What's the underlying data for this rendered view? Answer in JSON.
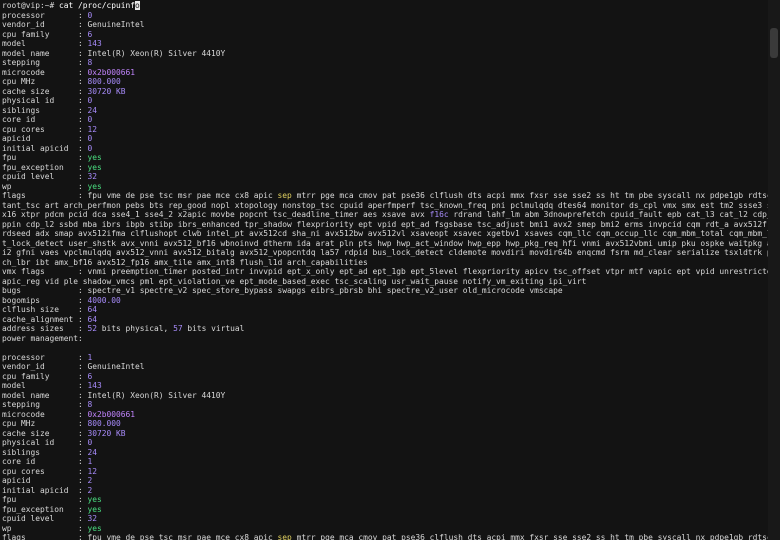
{
  "terminal": {
    "prompt": "root@vip:~#",
    "command_pre": "cat /proc/cpuinf",
    "command_hl": "o",
    "blocks": [
      {
        "lines": [
          {
            "k": "processor       ",
            "v": "0",
            "c": "num"
          },
          {
            "k": "vendor_id       ",
            "v": "GenuineIntel",
            "c": "k"
          },
          {
            "k": "cpu family      ",
            "v": "6",
            "c": "num"
          },
          {
            "k": "model           ",
            "v": "143",
            "c": "num"
          },
          {
            "k": "model name      ",
            "v": "Intel(R) Xeon(R) Silver 4410Y",
            "c": "k"
          },
          {
            "k": "stepping        ",
            "v": "8",
            "c": "num"
          },
          {
            "k": "microcode       ",
            "v": "0x2b000661",
            "c": "hex"
          },
          {
            "k": "cpu MHz         ",
            "v": "800.000",
            "c": "num"
          },
          {
            "k": "cache size      ",
            "v": "30720 KB",
            "c": "num"
          },
          {
            "k": "physical id     ",
            "v": "0",
            "c": "num"
          },
          {
            "k": "siblings        ",
            "v": "24",
            "c": "num"
          },
          {
            "k": "core id         ",
            "v": "0",
            "c": "num"
          },
          {
            "k": "cpu cores       ",
            "v": "12",
            "c": "num"
          },
          {
            "k": "apicid          ",
            "v": "0",
            "c": "num"
          },
          {
            "k": "initial apicid  ",
            "v": "0",
            "c": "num"
          },
          {
            "k": "fpu             ",
            "v": "yes",
            "c": "yes"
          },
          {
            "k": "fpu_exception   ",
            "v": "yes",
            "c": "yes"
          },
          {
            "k": "cpuid level     ",
            "v": "32",
            "c": "num"
          },
          {
            "k": "wp              ",
            "v": "yes",
            "c": "yes"
          }
        ],
        "flags_label": "flags           ",
        "flags_lines": [
          ": fpu vme de pse tsc msr pae mce cx8 apic ",
          "sep",
          " mtrr pge mca cmov pat pse36 clflush dts acpi mmx fxsr sse sse2 ss ht tm pbe syscall nx pdpe1gb rdtscp lm cons"
        ],
        "flags_rest": [
          "tant_tsc art arch_perfmon pebs bts rep_good nopl xtopology nonstop_tsc cpuid aperfmperf tsc_known_freq pni pclmulqdq dtes64 monitor ds_cpl vmx smx est tm2 ssse3 sdbg fma c",
          "x16 xtpr pdcm pcid dca sse4_1 sse4_2 x2apic movbe popcnt tsc_deadline_timer aes xsave avx ",
          "f16c",
          " rdrand lahf_lm abm 3dnowprefetch cpuid_fault epb cat_l3 cat_l2 cdp_l3 intel_",
          "ppin cdp_l2 ssbd mba ibrs ibpb stibp ibrs_enhanced tpr_shadow flexpriority ept vpid ept_ad fsgsbase tsc_adjust bmi1 avx2 smep bmi2 erms invpcid cqm rdt_a avx512f avx512dq ",
          "rdseed adx smap avx512ifma clflushopt clwb intel_pt avx512cd sha_ni avx512bw avx512vl xsaveopt xsavec xgetbv1 xsaves cqm_llc cqm_occup_llc cqm_mbm_total cqm_mbm_local spli",
          "t_lock_detect user_shstk avx_vnni avx512_bf16 wbnoinvd dtherm ida arat pln pts hwp hwp_act_window hwp_epp hwp_pkg_req hfi vnmi avx512vbmi umip pku ospke waitpkg avx512_vbm",
          "i2 gfni vaes vpclmulqdq avx512_vnni avx512_bitalg avx512_vpopcntdq la57 rdpid bus_lock_detect cldemote movdiri movdir64b enqcmd fsrm md_clear serialize tsxldtrk pconfig ar",
          "ch_lbr ibt amx_bf16 avx512_fp16 amx_tile amx_int8 flush_l1d arch_capabilities"
        ],
        "vmx_label": "vmx flags       ",
        "vmx_lines": [
          ": vnmi preemption_timer posted_intr invvpid ept_x_only ept_ad ept_1gb ept_5level flexpriority apicv tsc_offset vtpr mtf vapic ept vpid unrestricted_guest v",
          "apic_reg vid ple shadow_vmcs pml ept_violation_ve ept_mode_based_exec tsc_scaling usr_wait_pause notify_vm_exiting ipi_virt"
        ],
        "bugs_label": "bugs            ",
        "bugs_value": ": spectre_v1 spectre_v2 spec_store_bypass swapgs eibrs_pbrsb bhi spectre_v2_user old_microcode vmscape",
        "bogomips_label": "bogomips        ",
        "bogomips_value": "4000.00",
        "clflush_label": "clflush size    ",
        "clflush_value": "64",
        "cache_align_label": "cache_alignment ",
        "cache_align_value": "64",
        "addr_label": "address sizes   ",
        "addr_phys": "52",
        "addr_mid": " bits physical, ",
        "addr_virt": "57",
        "addr_end": " bits virtual",
        "power_label": "power management:"
      },
      {
        "lines": [
          {
            "k": "processor       ",
            "v": "1",
            "c": "num"
          },
          {
            "k": "vendor_id       ",
            "v": "GenuineIntel",
            "c": "k"
          },
          {
            "k": "cpu family      ",
            "v": "6",
            "c": "num"
          },
          {
            "k": "model           ",
            "v": "143",
            "c": "num"
          },
          {
            "k": "model name      ",
            "v": "Intel(R) Xeon(R) Silver 4410Y",
            "c": "k"
          },
          {
            "k": "stepping        ",
            "v": "8",
            "c": "num"
          },
          {
            "k": "microcode       ",
            "v": "0x2b000661",
            "c": "hex"
          },
          {
            "k": "cpu MHz         ",
            "v": "800.000",
            "c": "num"
          },
          {
            "k": "cache size      ",
            "v": "30720 KB",
            "c": "num"
          },
          {
            "k": "physical id     ",
            "v": "0",
            "c": "num"
          },
          {
            "k": "siblings        ",
            "v": "24",
            "c": "num"
          },
          {
            "k": "core id         ",
            "v": "1",
            "c": "num"
          },
          {
            "k": "cpu cores       ",
            "v": "12",
            "c": "num"
          },
          {
            "k": "apicid          ",
            "v": "2",
            "c": "num"
          },
          {
            "k": "initial apicid  ",
            "v": "2",
            "c": "num"
          },
          {
            "k": "fpu             ",
            "v": "yes",
            "c": "yes"
          },
          {
            "k": "fpu_exception   ",
            "v": "yes",
            "c": "yes"
          },
          {
            "k": "cpuid level     ",
            "v": "32",
            "c": "num"
          },
          {
            "k": "wp              ",
            "v": "yes",
            "c": "yes"
          }
        ],
        "flags_label": "flags           ",
        "flags_lines": [
          ": fpu vme de pse tsc msr pae mce cx8 apic ",
          "sep",
          " mtrr pge mca cmov pat pse36 clflush dts acpi mmx fxsr sse sse2 ss ht tm pbe syscall nx pdpe1gb rdtscp lm cons"
        ]
      }
    ]
  },
  "colors": {
    "background": "#131313",
    "text": "#d8d8d8",
    "number": "#a78bfa",
    "yes": "#4ade80",
    "sep": "#e0d060"
  }
}
